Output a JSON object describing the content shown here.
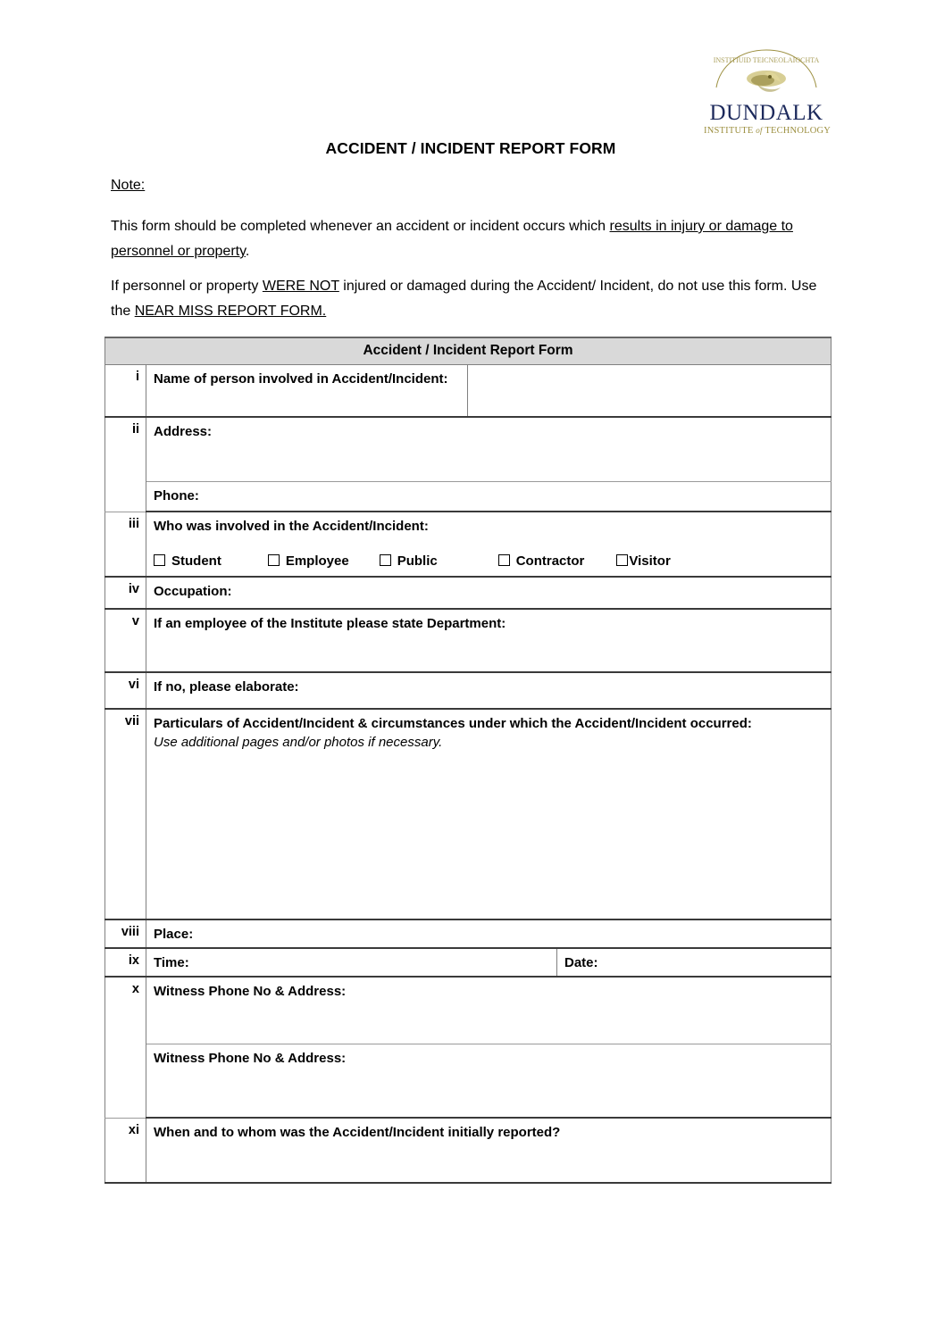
{
  "logo": {
    "name": "DUNDALK",
    "subtitle_pre": "INSTITUTE",
    "subtitle_of": "of",
    "subtitle_post": "TECHNOLOGY",
    "crest_alt": "dundalk-institute-crest",
    "navy": "#1d2a5c",
    "gold": "#9c8f3f"
  },
  "document": {
    "title": "ACCIDENT / INCIDENT REPORT FORM",
    "note_heading": "Note:",
    "paragraph_1_pre": "This form should be completed whenever an accident or incident occurs which ",
    "paragraph_1_underlined": "results in injury or damage to personnel or property",
    "paragraph_1_post": ".",
    "paragraph_2_pre": "If personnel or property ",
    "paragraph_2_underlined_1": "WERE NOT",
    "paragraph_2_mid": " injured or damaged during the Accident/ Incident, do not use this form. Use the ",
    "paragraph_2_underlined_2": "NEAR MISS REPORT FORM."
  },
  "table": {
    "header": "Accident / Incident Report Form",
    "header_bg": "#d9d9d9",
    "rows": [
      {
        "numeral": "i",
        "label": "Name of person involved in Accident/Incident:",
        "split_value_column": true
      },
      {
        "numeral": "ii",
        "label": "Address:"
      },
      {
        "numeral": "",
        "label": "Phone:"
      },
      {
        "numeral": "iii",
        "label": "Who was involved in the Accident/Incident:"
      },
      {
        "numeral": "iv",
        "label": "Occupation:"
      },
      {
        "numeral": "v",
        "label": "If an employee of the Institute please state Department:"
      },
      {
        "numeral": "vi",
        "label": "If no, please elaborate:"
      },
      {
        "numeral": "vii",
        "label": "Particulars of Accident/Incident & circumstances under which the Accident/Incident occurred:",
        "sublabel": "Use additional pages and/or photos if necessary."
      },
      {
        "numeral": "viii",
        "label": "Place:"
      },
      {
        "numeral": "ix",
        "label": "Time:",
        "second_label": "Date:"
      },
      {
        "numeral": "x",
        "label": "Witness Phone No & Address:"
      },
      {
        "numeral": "",
        "label": "Witness Phone No & Address:"
      },
      {
        "numeral": "xi",
        "label": "When and to whom was the Accident/Incident initially reported?"
      }
    ],
    "checkboxes": [
      {
        "label": "Student"
      },
      {
        "label": "Employee"
      },
      {
        "label": "Public"
      },
      {
        "label": "Contractor"
      },
      {
        "label": "Visitor"
      }
    ]
  }
}
